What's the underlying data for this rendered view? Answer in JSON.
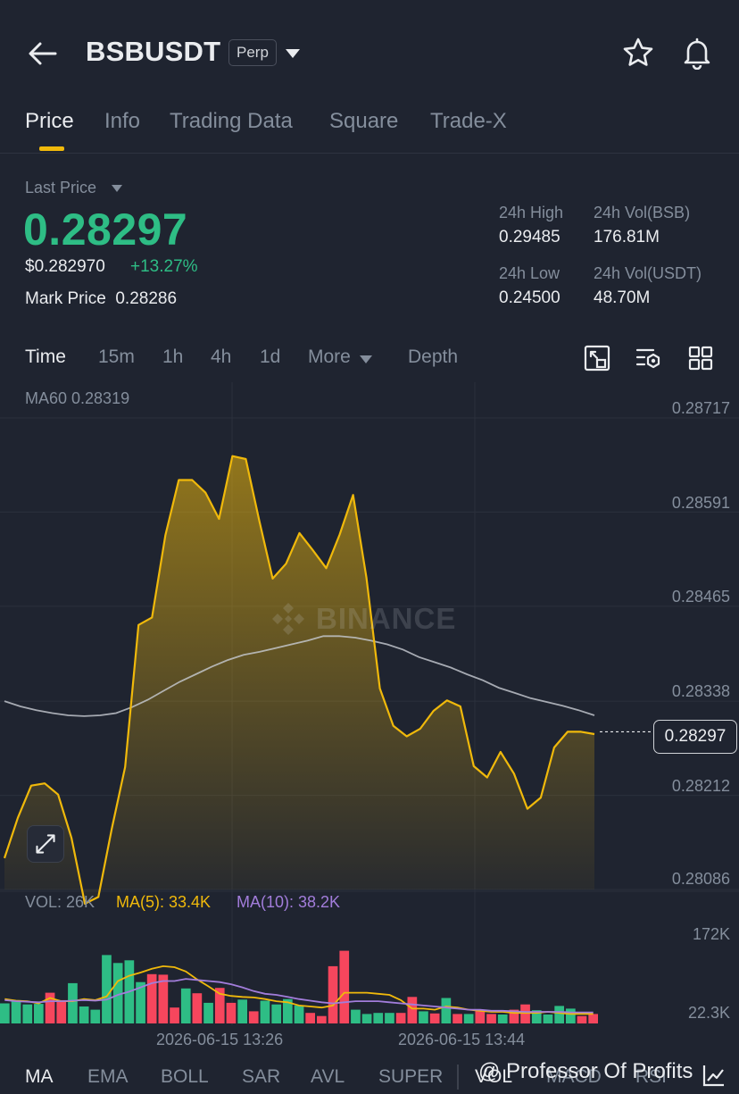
{
  "header": {
    "symbol": "BSBUSDT",
    "contract_type": "Perp"
  },
  "tabs": [
    {
      "label": "Price",
      "active": true
    },
    {
      "label": "Info"
    },
    {
      "label": "Trading Data"
    },
    {
      "label": "Square"
    },
    {
      "label": "Trade-X"
    }
  ],
  "ticker": {
    "last_price_label": "Last Price",
    "last_price": "0.28297",
    "usd_price": "$0.282970",
    "change_pct": "+13.27%",
    "mark_price_label": "Mark Price",
    "mark_price": "0.28286",
    "high_label": "24h High",
    "high": "0.29485",
    "low_label": "24h Low",
    "low": "0.24500",
    "vol_base_label": "24h Vol(BSB)",
    "vol_base": "176.81M",
    "vol_quote_label": "24h Vol(USDT)",
    "vol_quote": "48.70M"
  },
  "intervals": [
    {
      "label": "Time",
      "active": true
    },
    {
      "label": "15m"
    },
    {
      "label": "1h"
    },
    {
      "label": "4h"
    },
    {
      "label": "1d"
    },
    {
      "label": "More"
    },
    {
      "label": "Depth"
    }
  ],
  "colors": {
    "up": "#2ebd85",
    "down": "#f6465d",
    "accent": "#f0b90b",
    "ma10": "#a27ddb",
    "ma60": "#c8ccd3"
  },
  "watermark": "BINANCE",
  "chart_data": {
    "type": "area",
    "ma60_label": "MA60 0.28319",
    "price_axis": [
      0.28717,
      0.28591,
      0.28465,
      0.28338,
      0.28212,
      0.28086
    ],
    "ylim": [
      0.28086,
      0.28717
    ],
    "current_price": 0.28297,
    "x_ticks": [
      "2026-06-15 13:26",
      "2026-06-15 13:44"
    ],
    "price": [
      0.28128,
      0.28182,
      0.28225,
      0.28228,
      0.28213,
      0.28155,
      0.28067,
      0.28076,
      0.28167,
      0.2825,
      0.2844,
      0.2845,
      0.2856,
      0.28634,
      0.28634,
      0.28617,
      0.28582,
      0.28666,
      0.28662,
      0.2858,
      0.28502,
      0.28522,
      0.28563,
      0.2854,
      0.28516,
      0.28561,
      0.28614,
      0.28503,
      0.28355,
      0.28305,
      0.28291,
      0.28301,
      0.28325,
      0.28339,
      0.28331,
      0.28251,
      0.28236,
      0.2827,
      0.28241,
      0.28194,
      0.28209,
      0.28276,
      0.28297,
      0.28297,
      0.28294
    ],
    "ma60": [
      0.28338,
      0.28331,
      0.28326,
      0.28322,
      0.28319,
      0.28318,
      0.28319,
      0.28322,
      0.2833,
      0.2834,
      0.28352,
      0.28364,
      0.28374,
      0.28384,
      0.28393,
      0.284,
      0.28404,
      0.28409,
      0.28414,
      0.28419,
      0.28425,
      0.28425,
      0.28423,
      0.28419,
      0.28414,
      0.28407,
      0.28397,
      0.2839,
      0.28383,
      0.28374,
      0.28366,
      0.28356,
      0.28349,
      0.28342,
      0.28337,
      0.28332,
      0.28326,
      0.28319
    ],
    "volume": {
      "legend": {
        "vol": "VOL: 26K",
        "ma5": "MA(5): 33.4K",
        "ma10": "MA(10): 38.2K"
      },
      "axis": [
        "172K",
        "22.3K"
      ],
      "ylim": [
        22.3,
        172
      ],
      "values": [
        40,
        46,
        38,
        39,
        60,
        46,
        78,
        34,
        28,
        131,
        116,
        121,
        80,
        95,
        94,
        32,
        68,
        59,
        41,
        69,
        41,
        47,
        25,
        45,
        38,
        48,
        36,
        22,
        16,
        110,
        139,
        28,
        20,
        22,
        22,
        22,
        52,
        25,
        21,
        50,
        20,
        20,
        28,
        20,
        19,
        28,
        38,
        27,
        19,
        35,
        30,
        16,
        20
      ],
      "directions": [
        "up",
        "up",
        "up",
        "up",
        "down",
        "down",
        "up",
        "up",
        "up",
        "up",
        "up",
        "up",
        "up",
        "down",
        "down",
        "down",
        "up",
        "down",
        "up",
        "down",
        "down",
        "up",
        "down",
        "up",
        "up",
        "up",
        "up",
        "down",
        "down",
        "down",
        "down",
        "up",
        "up",
        "up",
        "up",
        "down",
        "down",
        "up",
        "down",
        "up",
        "down",
        "up",
        "down",
        "down",
        "up",
        "down",
        "down",
        "up",
        "up",
        "up",
        "up",
        "down",
        "down"
      ],
      "ma5": [
        48,
        45,
        44,
        40,
        50,
        44,
        44,
        48,
        46,
        53,
        82,
        92,
        98,
        105,
        110,
        108,
        100,
        85,
        72,
        58,
        54,
        52,
        51,
        48,
        44,
        42,
        36,
        34,
        32,
        36,
        60,
        60,
        60,
        58,
        56,
        46,
        30,
        30,
        28,
        34,
        32,
        28,
        26,
        24,
        24,
        22,
        22,
        22,
        24,
        22,
        20,
        20,
        20
      ],
      "ma10": [
        46,
        44,
        43,
        42,
        44,
        44,
        45,
        46,
        45,
        47,
        56,
        62,
        70,
        78,
        82,
        82,
        86,
        84,
        82,
        80,
        76,
        70,
        63,
        58,
        56,
        52,
        48,
        45,
        42,
        40,
        42,
        44,
        44,
        44,
        42,
        40,
        38,
        36,
        34,
        32,
        30,
        28,
        28,
        26,
        26,
        25,
        24,
        24,
        24,
        24,
        23,
        23,
        23
      ]
    }
  },
  "indicators": [
    {
      "label": "MA",
      "active": true
    },
    {
      "label": "EMA"
    },
    {
      "label": "BOLL"
    },
    {
      "label": "SAR"
    },
    {
      "label": "AVL"
    },
    {
      "label": "SUPER"
    },
    {
      "label": "VOL"
    },
    {
      "label": "MACD"
    },
    {
      "label": "RSI"
    }
  ],
  "credit": "@ Professor Of Profits"
}
